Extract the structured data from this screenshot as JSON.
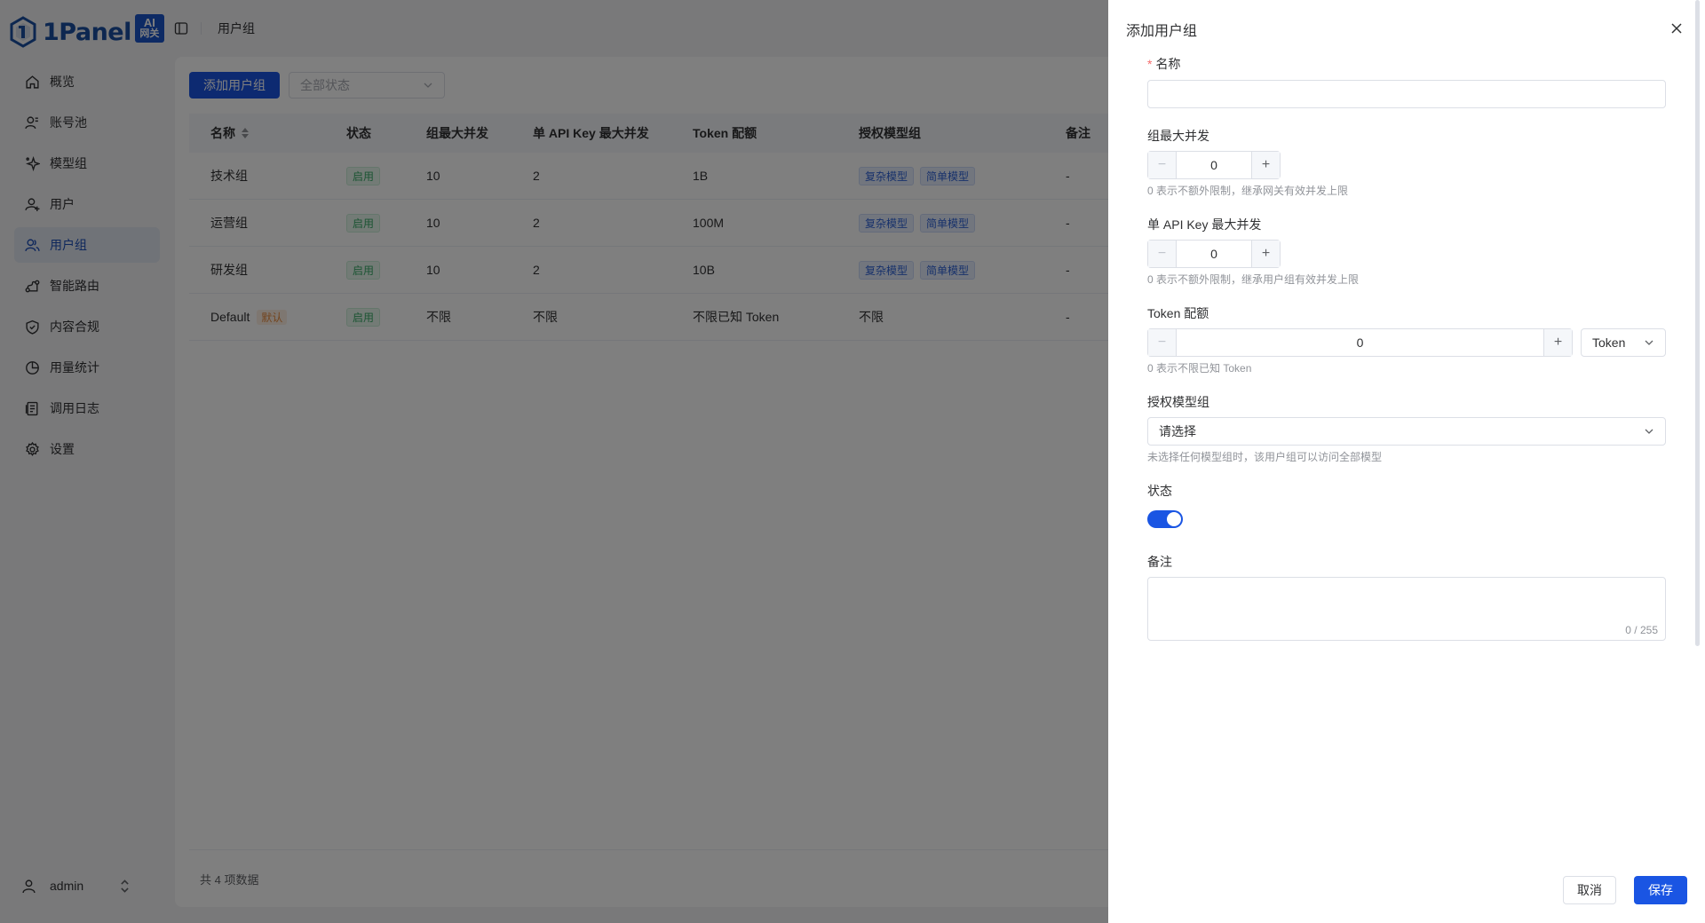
{
  "brand": {
    "name": "1Panel",
    "badge_top": "AI",
    "badge_bottom": "网关"
  },
  "sidebar": {
    "items": [
      {
        "label": "概览",
        "icon": "home-icon"
      },
      {
        "label": "账号池",
        "icon": "account-pool-icon"
      },
      {
        "label": "模型组",
        "icon": "sparkle-icon"
      },
      {
        "label": "用户",
        "icon": "user-add-icon"
      },
      {
        "label": "用户组",
        "icon": "users-icon",
        "active": true
      },
      {
        "label": "智能路由",
        "icon": "route-icon"
      },
      {
        "label": "内容合规",
        "icon": "shield-icon"
      },
      {
        "label": "用量统计",
        "icon": "pie-chart-icon"
      },
      {
        "label": "调用日志",
        "icon": "log-icon"
      },
      {
        "label": "设置",
        "icon": "gear-icon"
      }
    ],
    "user": "admin"
  },
  "header": {
    "breadcrumb": "用户组"
  },
  "toolbar": {
    "add_label": "添加用户组",
    "status_placeholder": "全部状态"
  },
  "table": {
    "columns": [
      "名称",
      "状态",
      "组最大并发",
      "单 API Key 最大并发",
      "Token 配额",
      "授权模型组",
      "备注"
    ],
    "rows": [
      {
        "name": "技术组",
        "status": "启用",
        "group_max": "10",
        "key_max": "2",
        "quota": "1B",
        "models": [
          "复杂模型",
          "简单模型"
        ],
        "note": "-"
      },
      {
        "name": "运营组",
        "status": "启用",
        "group_max": "10",
        "key_max": "2",
        "quota": "100M",
        "models": [
          "复杂模型",
          "简单模型"
        ],
        "note": "-"
      },
      {
        "name": "研发组",
        "status": "启用",
        "group_max": "10",
        "key_max": "2",
        "quota": "10B",
        "models": [
          "复杂模型",
          "简单模型"
        ],
        "note": "-"
      },
      {
        "name": "Default",
        "default_tag": "默认",
        "status": "启用",
        "group_max": "不限",
        "key_max": "不限",
        "quota": "不限已知 Token",
        "models_text": "不限",
        "note": "-"
      }
    ],
    "total": "共 4 项数据"
  },
  "drawer": {
    "title": "添加用户组",
    "name_label": "名称",
    "name_value": "",
    "group_max_label": "组最大并发",
    "group_max_value": "0",
    "group_max_hint": "0 表示不额外限制，继承网关有效并发上限",
    "key_max_label": "单 API Key 最大并发",
    "key_max_value": "0",
    "key_max_hint": "0 表示不额外限制，继承用户组有效并发上限",
    "quota_label": "Token 配额",
    "quota_value": "0",
    "quota_unit": "Token",
    "quota_hint": "0 表示不限已知 Token",
    "models_label": "授权模型组",
    "models_placeholder": "请选择",
    "models_hint": "未选择任何模型组时，该用户组可以访问全部模型",
    "status_label": "状态",
    "status_on": true,
    "note_label": "备注",
    "note_counter": "0 / 255",
    "cancel_label": "取消",
    "save_label": "保存"
  },
  "colors": {
    "primary": "#1a55e3",
    "brand": "#1a4fa0",
    "success": "#37a866",
    "warning": "#e68a3c"
  }
}
